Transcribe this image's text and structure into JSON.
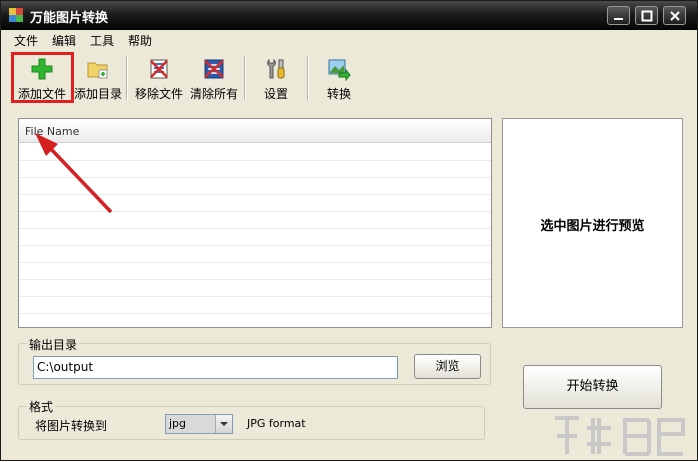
{
  "window": {
    "title": "万能图片转换"
  },
  "menu": [
    "文件",
    "编辑",
    "工具",
    "帮助"
  ],
  "toolbar": {
    "add_file": "添加文件",
    "add_dir": "添加目录",
    "remove_file": "移除文件",
    "clear_all": "清除所有",
    "settings": "设置",
    "convert": "转换"
  },
  "file_list": {
    "column_header": "File Name"
  },
  "preview": {
    "placeholder": "选中图片进行预览"
  },
  "output": {
    "group_label": "输出目录",
    "path": "C:\\output",
    "browse_label": "浏览"
  },
  "start_button": "开始转换",
  "format": {
    "group_label": "格式",
    "convert_to_label": "将图片转换到",
    "selected": "jpg",
    "description": "JPG format"
  },
  "colors": {
    "title_bar": "#1c1c1c",
    "highlight": "#e02020",
    "add_icon": "#2fb52f"
  }
}
